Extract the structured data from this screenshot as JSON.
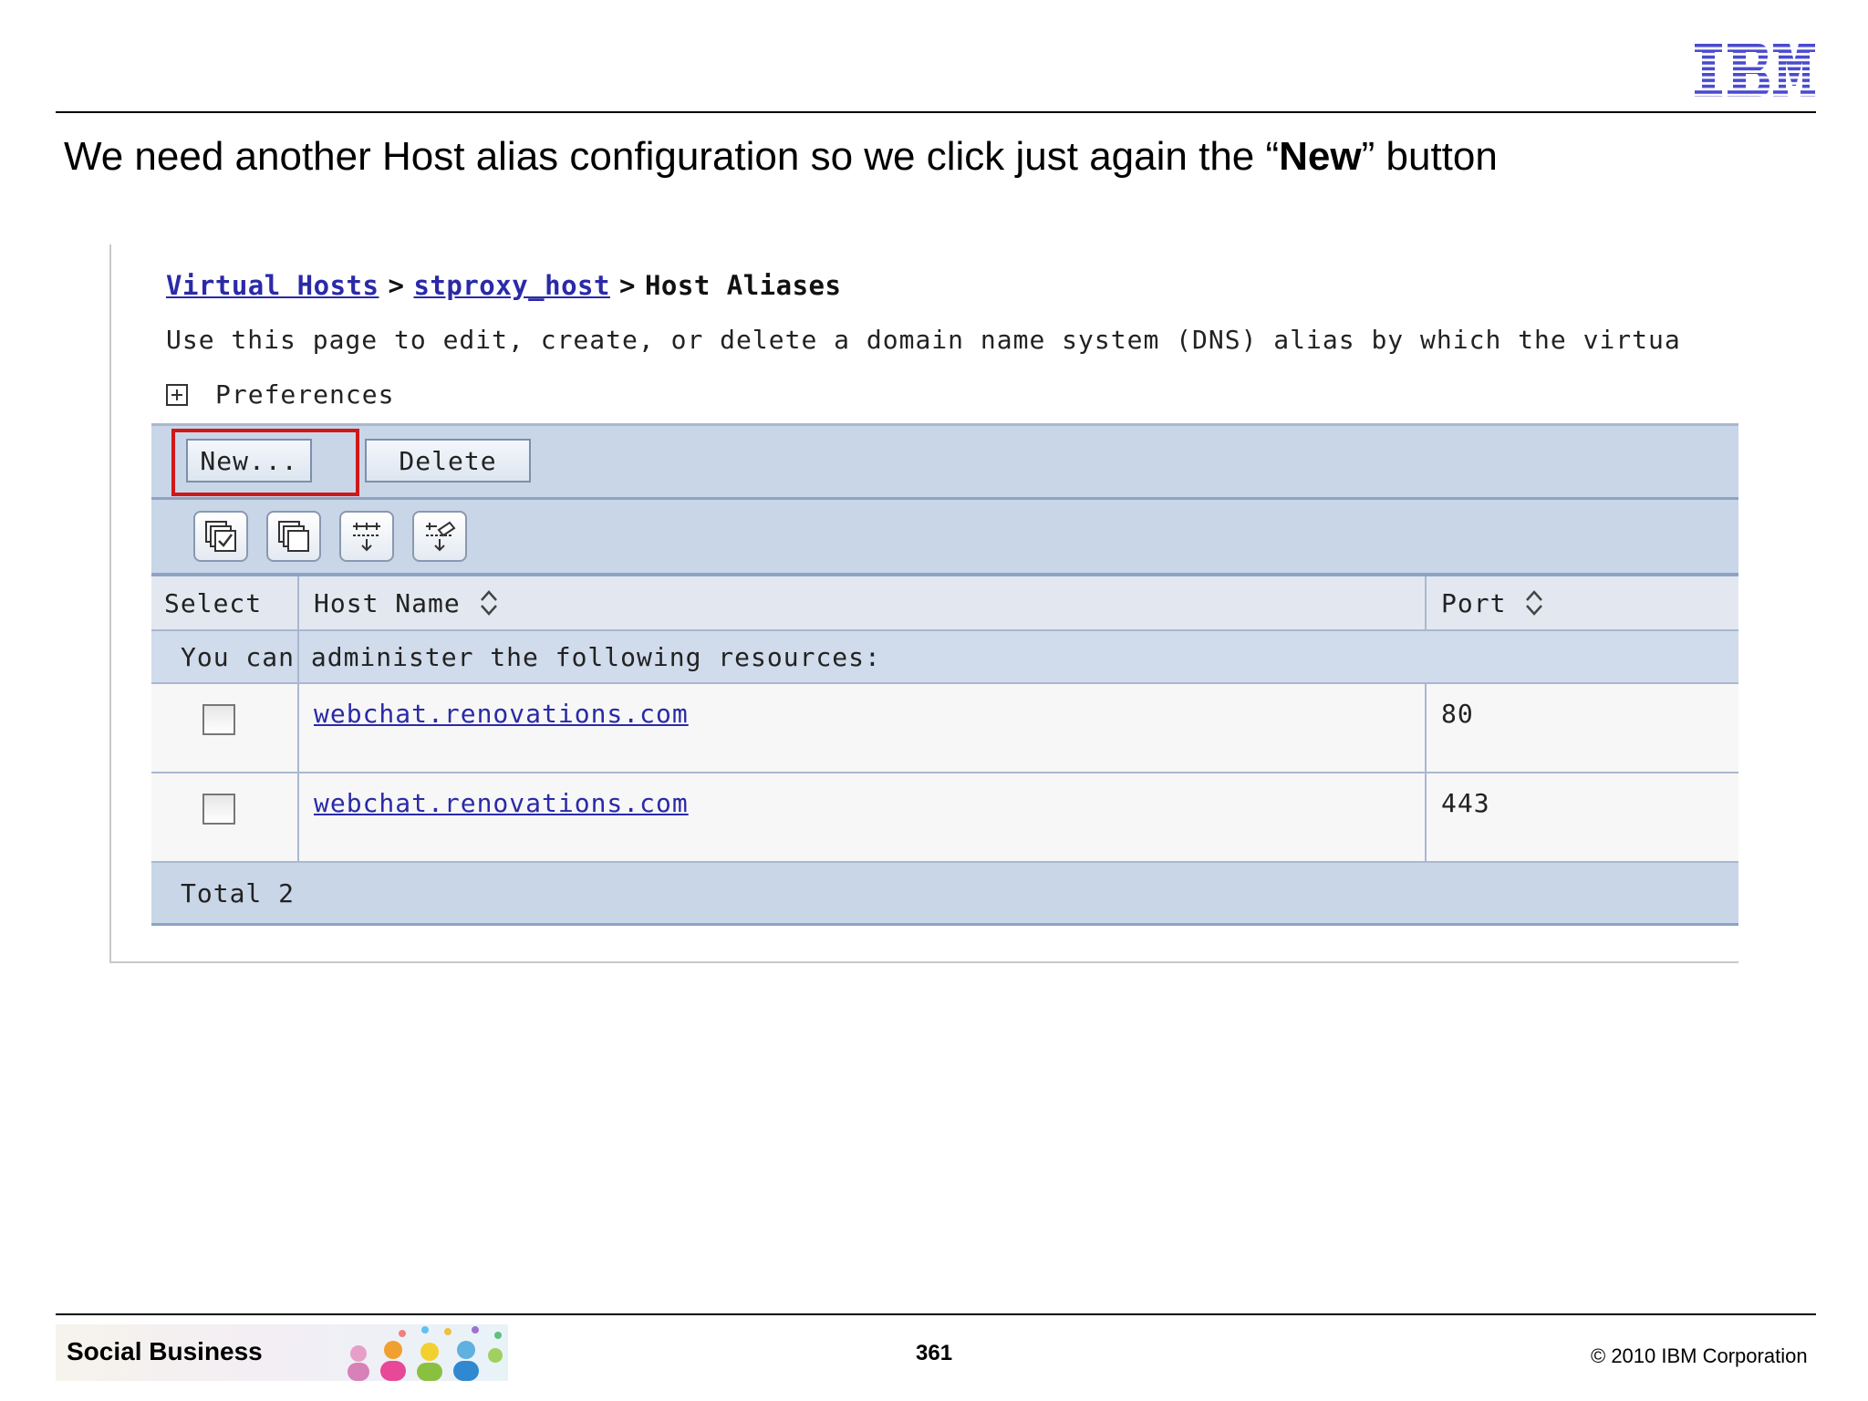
{
  "slide": {
    "logo_text": "IBM",
    "heading_before": "We need another Host alias configuration so we click just again the “",
    "heading_bold": "New",
    "heading_after": "” button"
  },
  "screenshot": {
    "breadcrumb": {
      "link1": "Virtual Hosts",
      "separator": ">",
      "link2": "stproxy_host",
      "current": "Host Aliases"
    },
    "description": "Use this page to edit, create, or delete a domain name system (DNS) alias by which the virtua",
    "preferences_label": "Preferences",
    "buttons": {
      "new": "New...",
      "delete": "Delete"
    },
    "toolbar_icons": [
      "select-all-icon",
      "deselect-all-icon",
      "show-filter-icon",
      "clear-filter-icon"
    ],
    "table": {
      "columns": {
        "select": "Select",
        "host_name": "Host Name",
        "port": "Port"
      },
      "admin_note": "You can administer the following resources:",
      "rows": [
        {
          "host": "webchat.renovations.com",
          "port": "80"
        },
        {
          "host": "webchat.renovations.com",
          "port": "443"
        }
      ],
      "total": "Total 2"
    },
    "colors": {
      "link": "#2a2aa8",
      "highlight": "#d01818",
      "bar": "#c9d6e8"
    }
  },
  "footer": {
    "brand": "Social Business",
    "page_number": "361",
    "copyright": "© 2010 IBM Corporation"
  }
}
